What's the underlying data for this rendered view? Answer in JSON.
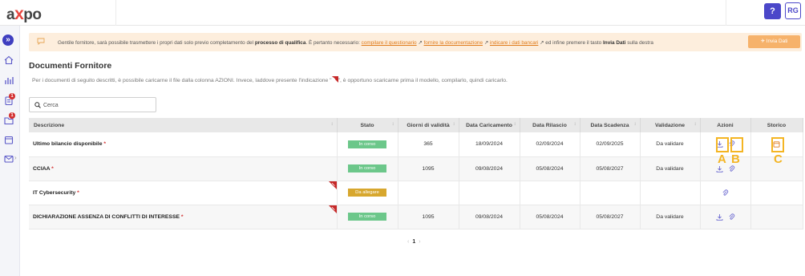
{
  "header": {
    "logo_a": "a",
    "logo_x": "x",
    "logo_po": "po",
    "help_label": "?",
    "user_initials": "RG"
  },
  "sidebar": {
    "toggle_glyph": "»",
    "badges": [
      "1",
      "1"
    ]
  },
  "banner": {
    "text_before": "Gentile fornitore, sarà possibile trasmettere i propri dati solo previo completamento del ",
    "bold_process": "processo di qualifica",
    "text_mid": ". È pertanto necessario: ",
    "link_questionnaire": "compilare il questionario",
    "link_docs": "fornire la documentazione",
    "link_bank": "indicare i dati bancari",
    "text_end": " ed infine premere il tasto ",
    "bold_send": "Invia Dati",
    "text_tail": " sulla destra",
    "send_button": "Invia Dati",
    "accent_color": "#e07b1a"
  },
  "page": {
    "title": "Documenti Fornitore",
    "subtitle_before": "Per i documenti di seguito descritti, è possibile caricarne il file dalla colonna AZIONI. Invece, laddove presente l'indicazione \"",
    "subtitle_after": "\", è opportuno scaricarne prima il modello, compilarlo, quindi caricarlo."
  },
  "search": {
    "placeholder": "Cerca",
    "value": ""
  },
  "table": {
    "headers": [
      "Descrizione",
      "Stato",
      "Giorni di validità",
      "Data Caricamento",
      "Data Rilascio",
      "Data Scadenza",
      "Validazione",
      "Azioni",
      "Storico"
    ],
    "rows": [
      {
        "desc": "Ultimo bilancio disponibile",
        "stato": "In corso",
        "giorni": "365",
        "caricamento": "18/09/2024",
        "rilascio": "02/09/2024",
        "scadenza": "02/09/2025",
        "validazione": "Da validare"
      },
      {
        "desc": "CCIAA",
        "stato": "In corso",
        "giorni": "1095",
        "caricamento": "09/08/2024",
        "rilascio": "05/08/2024",
        "scadenza": "05/08/2027",
        "validazione": "Da validare"
      },
      {
        "desc": "IT Cybersecurity",
        "stato": "Da allegare",
        "giorni": "",
        "caricamento": "",
        "rilascio": "",
        "scadenza": "",
        "validazione": ""
      },
      {
        "desc": "DICHIARAZIONE ASSENZA DI CONFLITTI DI INTERESSE",
        "stato": "In corso",
        "giorni": "1095",
        "caricamento": "09/08/2024",
        "rilascio": "05/08/2024",
        "scadenza": "05/08/2027",
        "validazione": "Da validare"
      }
    ],
    "required_mark": "*",
    "status_colors": {
      "in_corso": "#6cc78a",
      "da_allegare": "#d7a72e"
    }
  },
  "annotations": {
    "a": "A",
    "b": "B",
    "c": "C",
    "color": "#f4b523"
  },
  "pagination": {
    "prev": "‹",
    "current": "1",
    "next": "›"
  }
}
